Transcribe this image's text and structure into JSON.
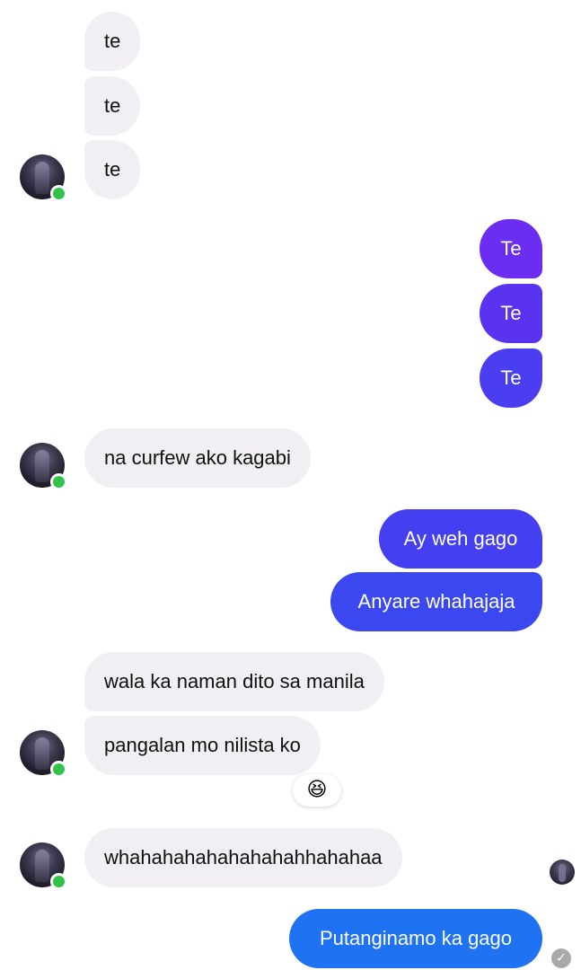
{
  "conversation": {
    "messages": [
      {
        "id": "m1",
        "from": "them",
        "text": "te"
      },
      {
        "id": "m2",
        "from": "them",
        "text": "te"
      },
      {
        "id": "m3",
        "from": "them",
        "text": "te"
      },
      {
        "id": "m4",
        "from": "me",
        "text": "Te"
      },
      {
        "id": "m5",
        "from": "me",
        "text": "Te"
      },
      {
        "id": "m6",
        "from": "me",
        "text": "Te"
      },
      {
        "id": "m7",
        "from": "them",
        "text": "na curfew ako kagabi"
      },
      {
        "id": "m8",
        "from": "me",
        "text": "Ay weh gago"
      },
      {
        "id": "m9",
        "from": "me",
        "text": "Anyare whahajaja"
      },
      {
        "id": "m10",
        "from": "them",
        "text": "wala ka naman dito sa manila"
      },
      {
        "id": "m11",
        "from": "them",
        "text": "pangalan mo nilista ko"
      },
      {
        "id": "m12",
        "from": "them",
        "text": "whahahahahahahahahhahahaa"
      },
      {
        "id": "m13",
        "from": "me",
        "text": "Putanginamo ka gago"
      }
    ],
    "reaction": {
      "on_message": "m11",
      "emoji": "😆"
    }
  },
  "status": {
    "seen_by_avatar": "contact-avatar",
    "delivered_icon": "checkmark-circle-icon",
    "delivered_glyph": "✓"
  },
  "colors": {
    "incoming_bubble": "#f1eff3",
    "outgoing_purple": "#6b2df2",
    "outgoing_indigo": "#4a3ef0",
    "outgoing_blue": "#1f72f2",
    "online_indicator": "#31c24a"
  }
}
